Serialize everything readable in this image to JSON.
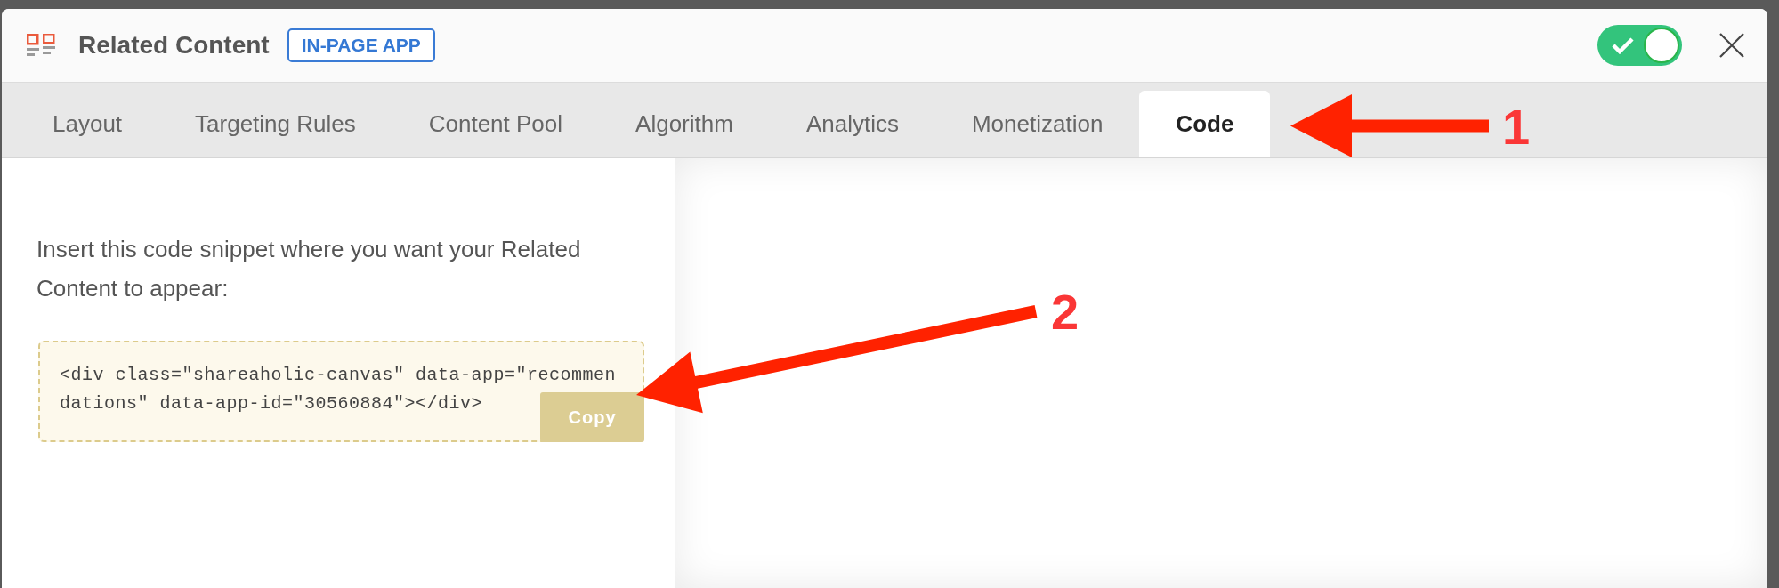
{
  "window": {
    "title": "Related Content",
    "badge": "IN-PAGE APP",
    "enabled": true
  },
  "tabs": [
    {
      "label": "Layout",
      "selected": false
    },
    {
      "label": "Targeting Rules",
      "selected": false
    },
    {
      "label": "Content Pool",
      "selected": false
    },
    {
      "label": "Algorithm",
      "selected": false
    },
    {
      "label": "Analytics",
      "selected": false
    },
    {
      "label": "Monetization",
      "selected": false
    },
    {
      "label": "Code",
      "selected": true
    }
  ],
  "code_panel": {
    "instruction": "Insert this code snippet where you want your Related Content to appear:",
    "snippet": "<div class=\"shareaholic-canvas\" data-app=\"recommendations\" data-app-id=\"30560884\"></div>",
    "copy_button": "Copy"
  },
  "annotations": [
    {
      "label": "1"
    },
    {
      "label": "2"
    }
  ]
}
